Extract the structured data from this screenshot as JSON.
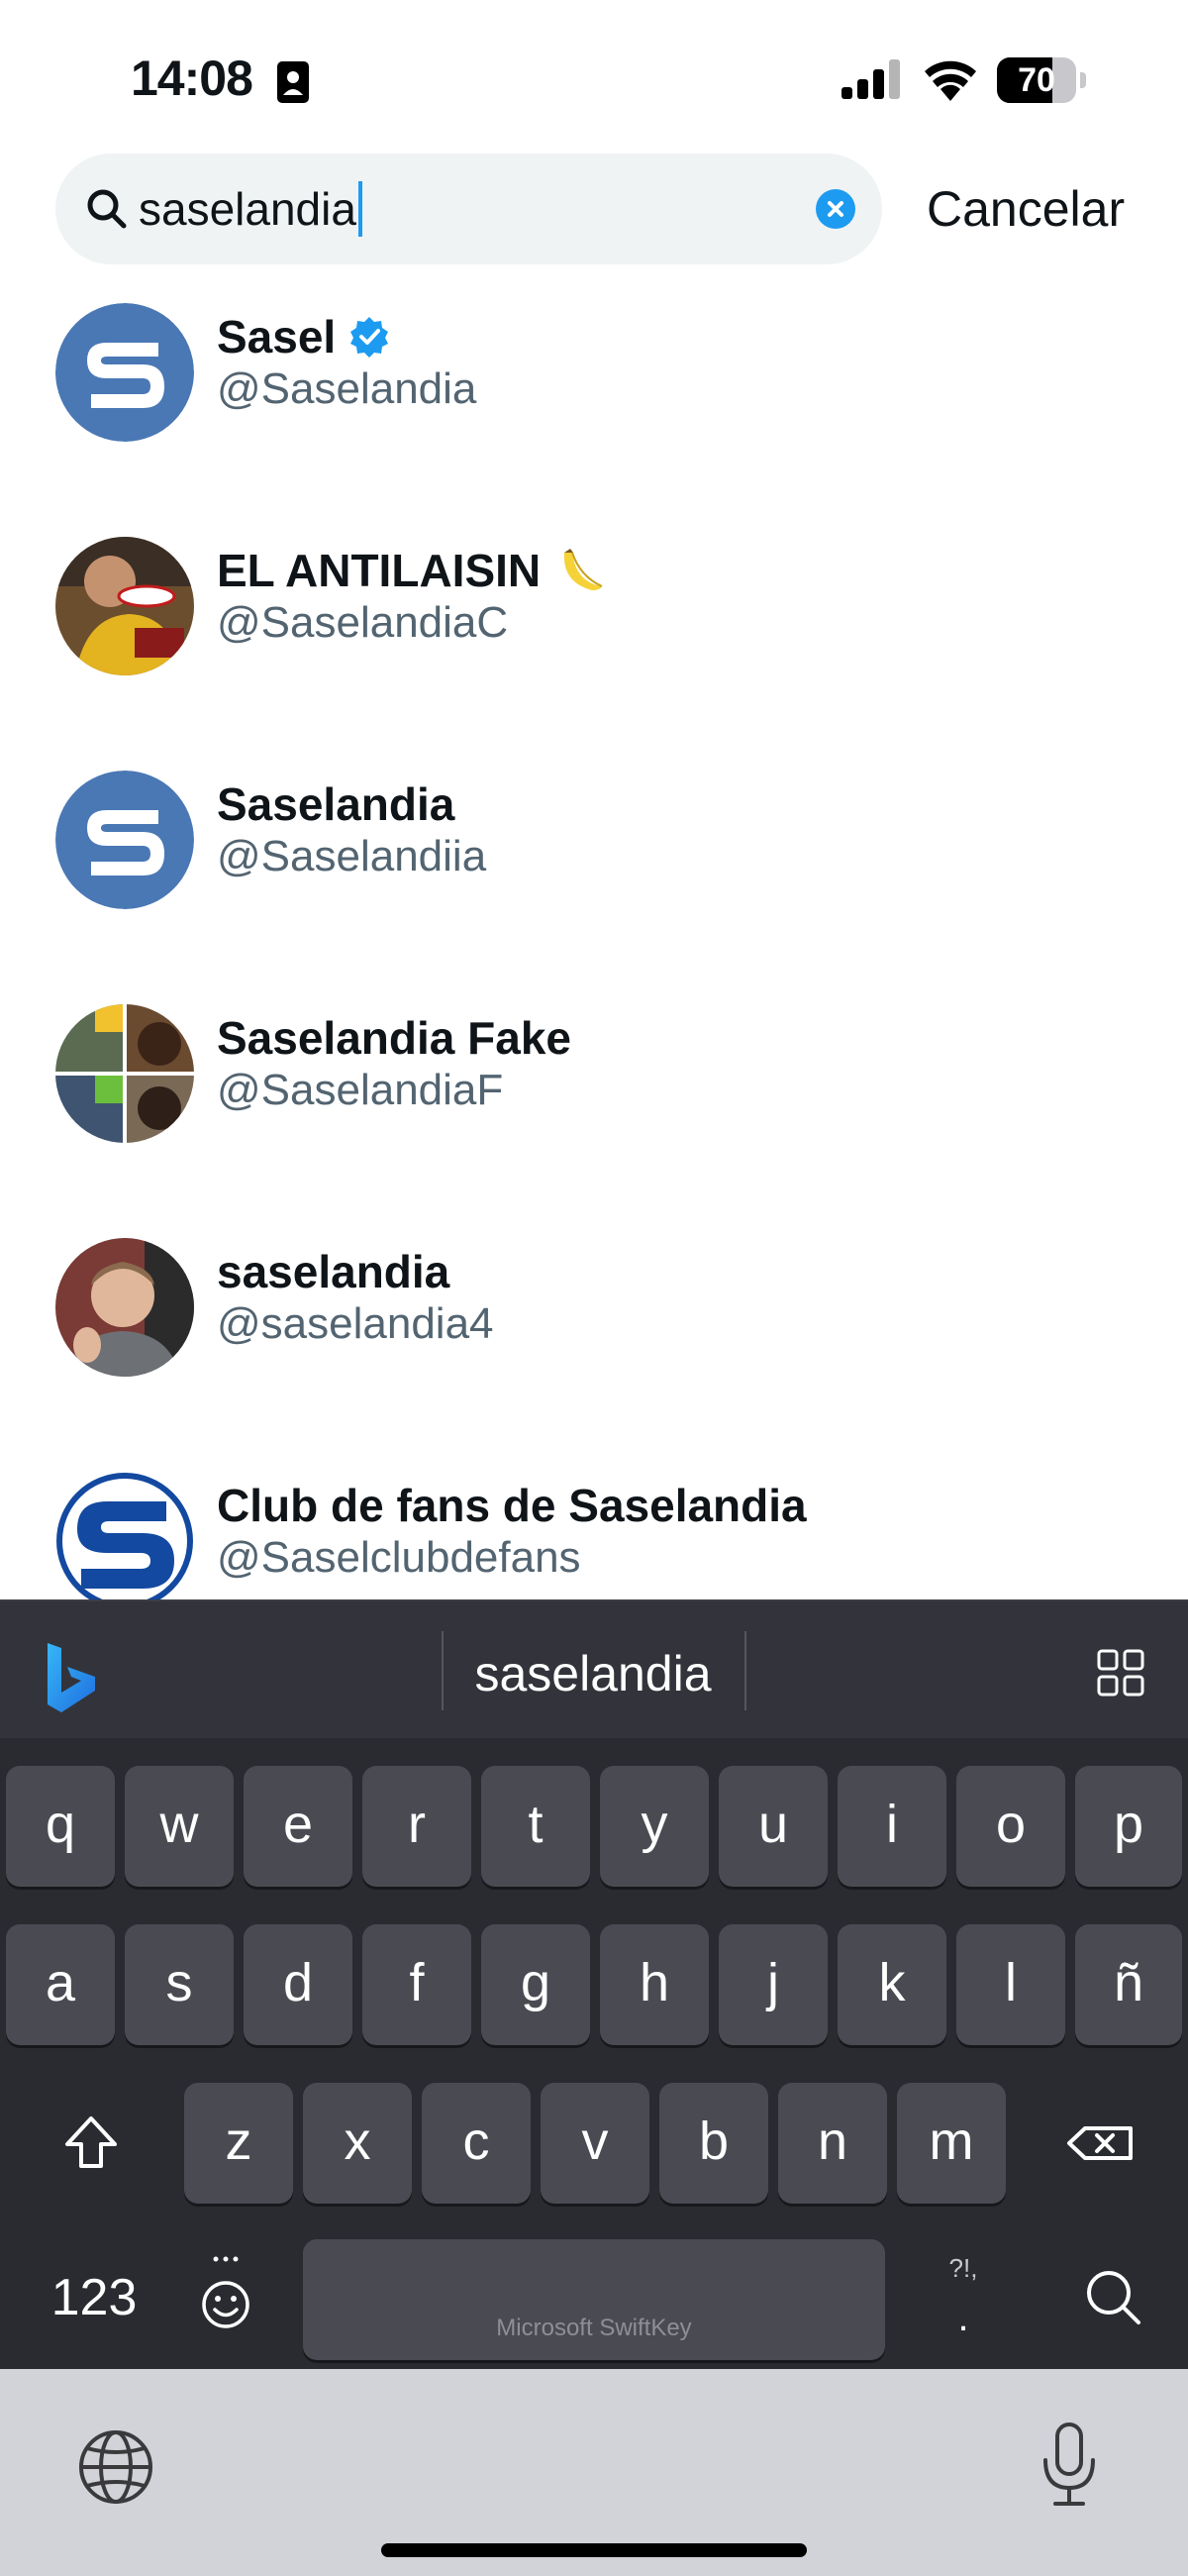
{
  "status_bar": {
    "time": "14:08",
    "battery_level": "70",
    "battery_fraction": 0.7
  },
  "search": {
    "query": "saselandia",
    "cancel_label": "Cancelar"
  },
  "results": [
    {
      "name": "Sasel",
      "handle": "@Saselandia",
      "verified": true,
      "avatar": "s-logo-light"
    },
    {
      "name": "EL ANTILAISIN",
      "handle": "@SaselandiaC",
      "emoji": "banana-icon",
      "avatar": "photo-man-yellow"
    },
    {
      "name": "Saselandia",
      "handle": "@Saselandiia",
      "avatar": "s-logo-light"
    },
    {
      "name": "Saselandia Fake",
      "handle": "@SaselandiaF",
      "avatar": "collage-photo"
    },
    {
      "name": "saselandia",
      "handle": "@saselandia4",
      "avatar": "photo-man-smiling"
    },
    {
      "name": "Club de fans de Saselandia",
      "handle": "@Saselclubdefans",
      "avatar": "s-logo-dark"
    }
  ],
  "keyboard": {
    "suggestion": "saselandia",
    "row1": [
      "q",
      "w",
      "e",
      "r",
      "t",
      "y",
      "u",
      "i",
      "o",
      "p"
    ],
    "row2": [
      "a",
      "s",
      "d",
      "f",
      "g",
      "h",
      "j",
      "k",
      "l",
      "ñ"
    ],
    "row3": [
      "z",
      "x",
      "c",
      "v",
      "b",
      "n",
      "m"
    ],
    "numbers_label": "123",
    "space_label": "Microsoft SwiftKey",
    "punct_label": "?!,",
    "colors": {
      "background": "#2a2b31",
      "key": "#4a4b52",
      "accent": "#1d9bf0"
    }
  }
}
